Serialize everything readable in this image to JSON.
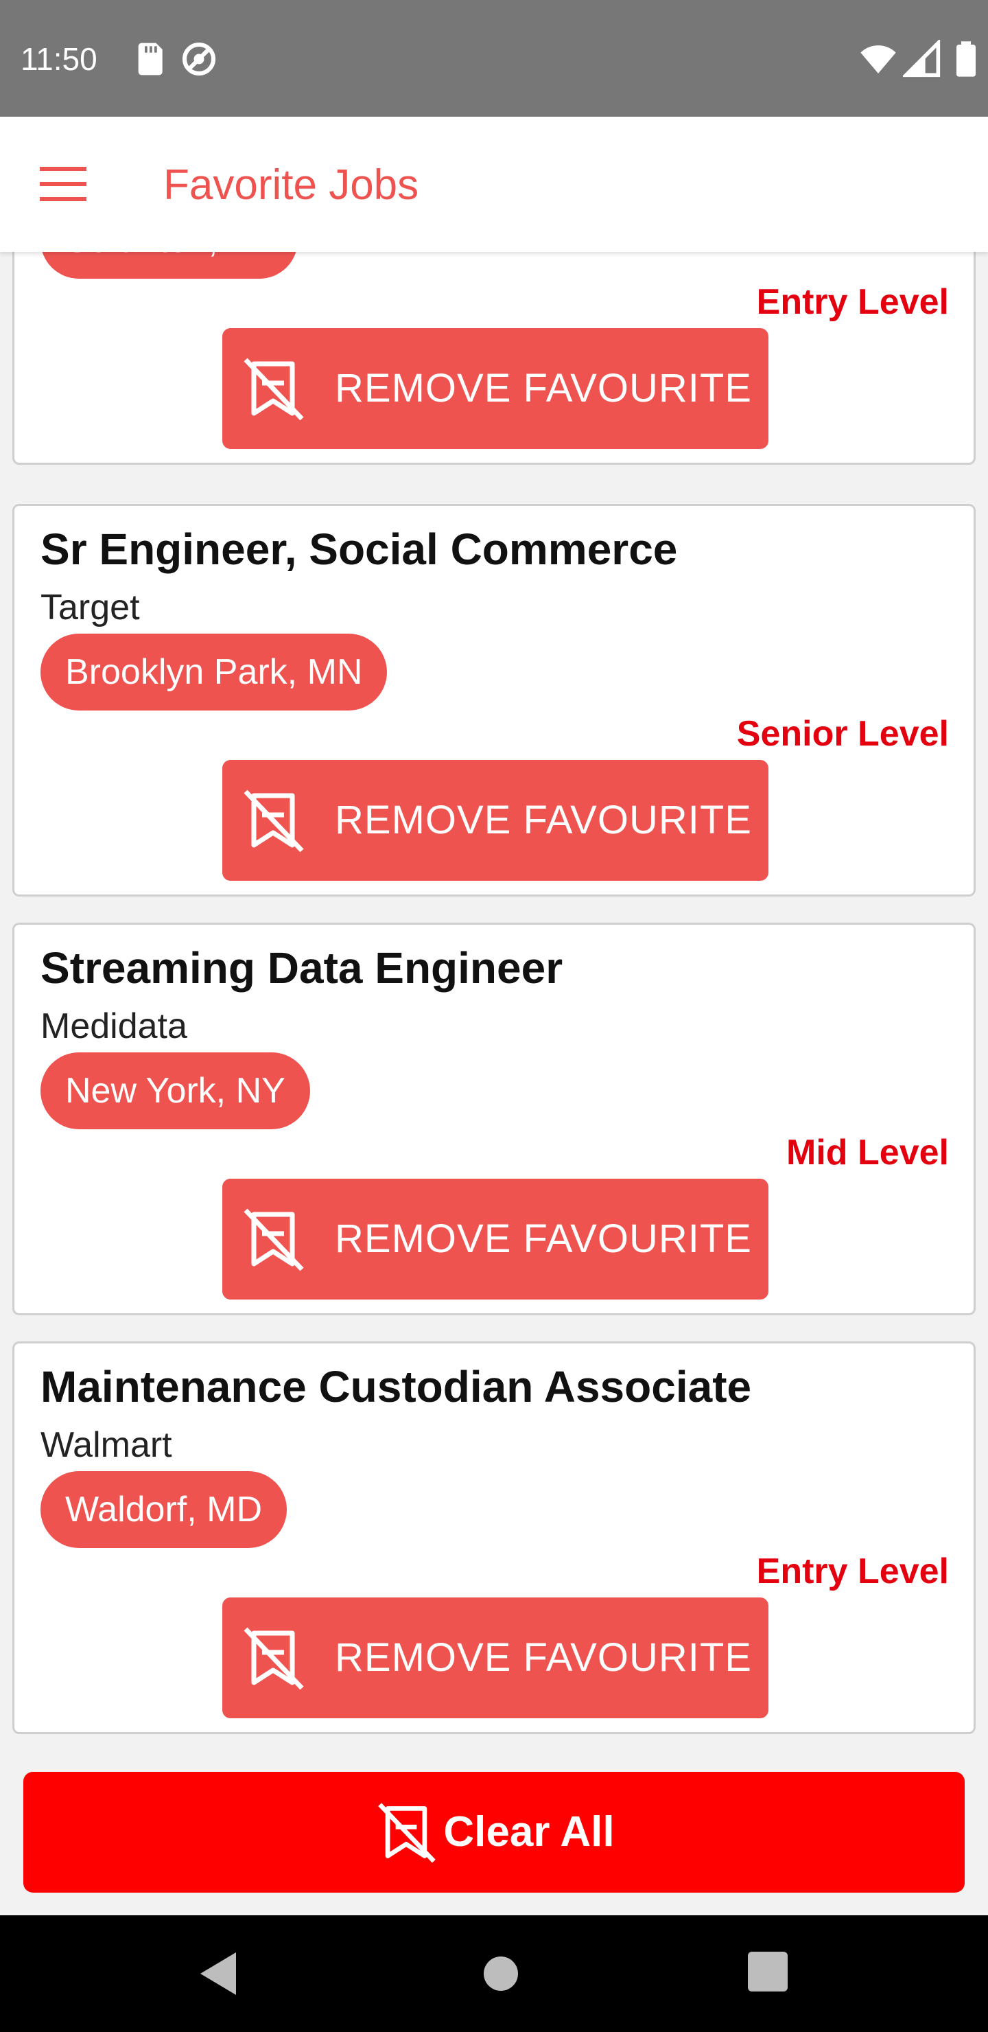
{
  "status_bar": {
    "time": "11:50",
    "icons": [
      "sd-card-icon",
      "sync-icon",
      "wifi-icon",
      "signal-icon",
      "battery-icon"
    ]
  },
  "app_bar": {
    "menu_icon": "hamburger-menu-icon",
    "title": "Favorite Jobs"
  },
  "colors": {
    "accent": "#ef5350",
    "level_text": "#e3000f",
    "clear_all": "#ff0000",
    "status_bar": "#777777"
  },
  "jobs": [
    {
      "title": "",
      "company": "",
      "location": "Scranton, PA",
      "level": "Entry Level",
      "action_label": "REMOVE FAVOURITE",
      "action_icon": "remove-favorite-icon"
    },
    {
      "title": "Sr Engineer, Social Commerce",
      "company": "Target",
      "location": "Brooklyn Park, MN",
      "level": "Senior Level",
      "action_label": "REMOVE FAVOURITE",
      "action_icon": "remove-favorite-icon"
    },
    {
      "title": "Streaming Data Engineer",
      "company": "Medidata",
      "location": "New York, NY",
      "level": "Mid Level",
      "action_label": "REMOVE FAVOURITE",
      "action_icon": "remove-favorite-icon"
    },
    {
      "title": "Maintenance Custodian Associate",
      "company": "Walmart",
      "location": "Waldorf, MD",
      "level": "Entry Level",
      "action_label": "REMOVE FAVOURITE",
      "action_icon": "remove-favorite-icon"
    }
  ],
  "clear_all": {
    "label": "Clear All",
    "icon": "remove-favorite-icon"
  },
  "nav_bar": {
    "icons": [
      "back-icon",
      "home-icon",
      "recent-apps-icon"
    ]
  }
}
